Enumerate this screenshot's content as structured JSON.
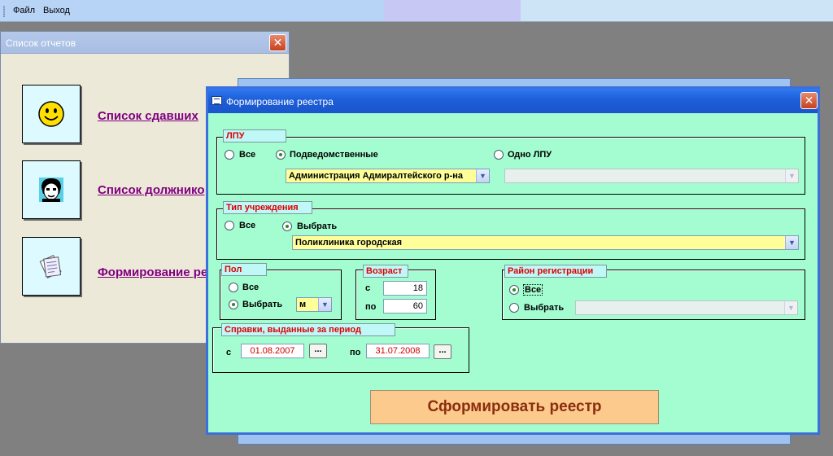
{
  "menu": {
    "file": "Файл",
    "exit": "Выход"
  },
  "reports_window": {
    "title": "Список отчетов",
    "close_icon": "close-icon",
    "items": [
      {
        "label": "Список сдавших",
        "icon": "smiley-icon"
      },
      {
        "label": "Список должнико",
        "icon": "face-icon"
      },
      {
        "label": "Формирование ре",
        "icon": "documents-icon"
      }
    ]
  },
  "dialog": {
    "title": "Формирование реестра",
    "lpu": {
      "legend": "ЛПУ",
      "opt_all": "Все",
      "opt_sub": "Подведомственные",
      "opt_one": "Одно ЛПУ",
      "selected": "sub",
      "sub_value": "Администрация Адмиралтейского р-на",
      "one_value": ""
    },
    "inst_type": {
      "legend": "Тип учреждения",
      "opt_all": "Все",
      "opt_select": "Выбрать",
      "selected": "select",
      "value": "Поликлиника городская"
    },
    "sex": {
      "legend": "Пол",
      "opt_all": "Все",
      "opt_select": "Выбрать",
      "selected": "select",
      "value": "м"
    },
    "age": {
      "legend": "Возраст",
      "from_label": "с",
      "to_label": "по",
      "from_value": "18",
      "to_value": "60"
    },
    "district": {
      "legend": "Район регистрации",
      "opt_all": "Все",
      "opt_select": "Выбрать",
      "selected": "all",
      "value": ""
    },
    "period": {
      "legend": "Справки, выданные за период",
      "from_label": "с",
      "to_label": "по",
      "from_value": "01.08.2007",
      "to_value": "31.07.2008",
      "picker_label": "..."
    },
    "submit_label": "Сформировать реестр"
  },
  "colors": {
    "dialog_bg": "#a3fdd1",
    "legend_text": "#e00000",
    "combo_bg": "#ffff99",
    "submit_bg": "#fcca8c",
    "link": "#800080"
  }
}
